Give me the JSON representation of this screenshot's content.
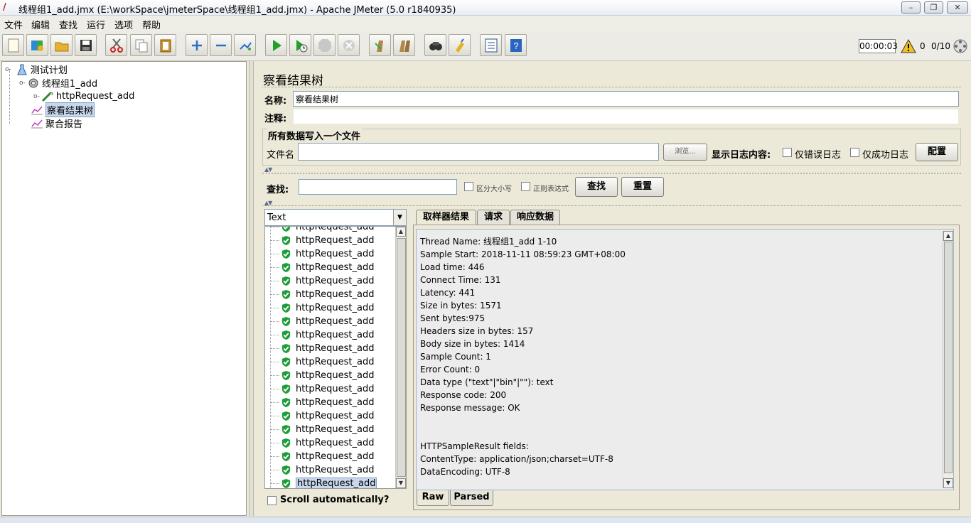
{
  "window": {
    "title": "线程组1_add.jmx (E:\\workSpace\\jmeterSpace\\线程组1_add.jmx) - Apache JMeter (5.0 r1840935)"
  },
  "menu": [
    "文件",
    "编辑",
    "查找",
    "运行",
    "选项",
    "帮助"
  ],
  "toolbar": {
    "icons": [
      "new-icon",
      "templates-icon",
      "open-icon",
      "save-icon",
      "cut-icon",
      "copy-icon",
      "paste-icon",
      "expand-icon",
      "collapse-icon",
      "toggle-icon",
      "start-icon",
      "start-no-timers-icon",
      "stop-icon",
      "shutdown-icon",
      "clear-icon",
      "clear-all-icon",
      "search-icon",
      "reset-search-icon",
      "function-helper-icon",
      "help-icon"
    ],
    "timer": "00:00:03",
    "error_count": "0",
    "threads": "0/10"
  },
  "tree": {
    "items": [
      {
        "label": "测试计划",
        "icon": "test-plan-icon",
        "level": 0
      },
      {
        "label": "线程组1_add",
        "icon": "thread-group-icon",
        "level": 1
      },
      {
        "label": "httpRequest_add",
        "icon": "sampler-icon",
        "level": 2
      },
      {
        "label": "察看结果树",
        "icon": "listener-icon",
        "level": 1,
        "selected": true
      },
      {
        "label": "聚合报告",
        "icon": "listener-icon",
        "level": 1
      }
    ]
  },
  "component": {
    "title": "察看结果树",
    "name_label": "名称:",
    "name_value": "察看结果树",
    "comment_label": "注释:",
    "comment_value": "",
    "file_section_title": "所有数据写入一个文件",
    "filename_label": "文件名",
    "filename_value": "",
    "browse_label": "浏览...",
    "log_label": "显示日志内容:",
    "errors_only_label": "仅错误日志",
    "success_only_label": "仅成功日志",
    "configure_label": "配置"
  },
  "search": {
    "label": "查找:",
    "value": "",
    "case_sensitive_label": "区分大小写",
    "regex_label": "正则表达式",
    "search_button": "查找",
    "reset_button": "重置"
  },
  "results": {
    "renderer": "Text",
    "partial_top_label": "httpRequest_add",
    "items": [
      "httpRequest_add",
      "httpRequest_add",
      "httpRequest_add",
      "httpRequest_add",
      "httpRequest_add",
      "httpRequest_add",
      "httpRequest_add",
      "httpRequest_add",
      "httpRequest_add",
      "httpRequest_add",
      "httpRequest_add",
      "httpRequest_add",
      "httpRequest_add",
      "httpRequest_add",
      "httpRequest_add",
      "httpRequest_add",
      "httpRequest_add",
      "httpRequest_add",
      "httpRequest_add"
    ],
    "selected_index": 18,
    "scroll_auto_label": "Scroll automatically?"
  },
  "detail": {
    "tabs": [
      "取样器结果",
      "请求",
      "响应数据"
    ],
    "active_tab": 0,
    "lines": [
      "Thread Name: 线程组1_add 1-10",
      "Sample Start: 2018-11-11 08:59:23 GMT+08:00",
      "Load time: 446",
      "Connect Time: 131",
      "Latency: 441",
      "Size in bytes: 1571",
      "Sent bytes:975",
      "Headers size in bytes: 157",
      "Body size in bytes: 1414",
      "Sample Count: 1",
      "Error Count: 0",
      "Data type (\"text\"|\"bin\"|\"\"): text",
      "Response code: 200",
      "Response message: OK",
      "",
      "",
      "HTTPSampleResult fields:",
      "ContentType: application/json;charset=UTF-8",
      "DataEncoding: UTF-8"
    ],
    "bottom_tabs": [
      "Raw",
      "Parsed"
    ]
  }
}
